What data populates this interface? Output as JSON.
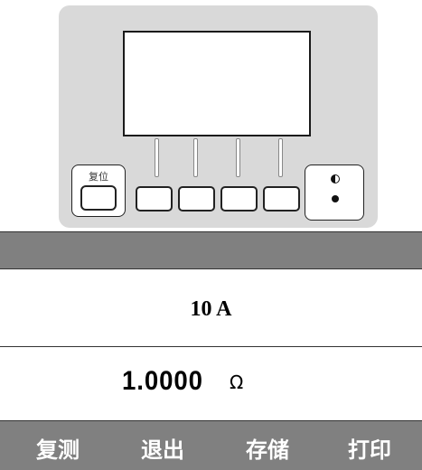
{
  "device_panel": {
    "reset_button_label": "复位",
    "soft_keys_count": 4,
    "icons": [
      "contrast-icon",
      "dot-icon"
    ]
  },
  "measurement": {
    "current": "10 A",
    "resistance_value": "1.0000",
    "resistance_unit": "Ω"
  },
  "action_bar": {
    "items": [
      {
        "label": "复测"
      },
      {
        "label": "退出"
      },
      {
        "label": "存储"
      },
      {
        "label": "打印"
      }
    ]
  },
  "colors": {
    "panel_bg": "#d9d9d9",
    "bar_bg": "#808080",
    "bar_text": "#ffffff"
  }
}
